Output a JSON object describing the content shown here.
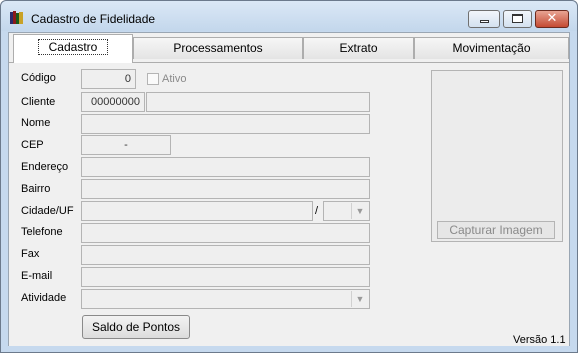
{
  "window": {
    "title": "Cadastro de Fidelidade",
    "minimize_icon": "minimize-icon",
    "maximize_icon": "maximize-icon",
    "close_icon": "close-icon",
    "close_glyph": "✕",
    "app_icon": "books-app-icon"
  },
  "tabs": [
    {
      "label": "Cadastro"
    },
    {
      "label": "Processamentos"
    },
    {
      "label": "Extrato"
    },
    {
      "label": "Movimentação"
    }
  ],
  "form": {
    "codigo": {
      "label": "Código",
      "value": "0"
    },
    "ativo": {
      "label": "Ativo",
      "checked": false
    },
    "cliente": {
      "label": "Cliente",
      "code": "00000000",
      "name": ""
    },
    "nome": {
      "label": "Nome",
      "value": ""
    },
    "cep": {
      "label": "CEP",
      "value": "-"
    },
    "endereco": {
      "label": "Endereço",
      "value": ""
    },
    "bairro": {
      "label": "Bairro",
      "value": ""
    },
    "cidade_uf": {
      "label": "Cidade/UF",
      "cidade": "",
      "separator": "/",
      "uf": ""
    },
    "telefone": {
      "label": "Telefone",
      "value": ""
    },
    "fax": {
      "label": "Fax",
      "value": ""
    },
    "email": {
      "label": "E-mail",
      "value": ""
    },
    "atividade": {
      "label": "Atividade",
      "value": ""
    }
  },
  "photo": {
    "capture_label": "Capturar Imagem"
  },
  "saldo_button": "Saldo de Pontos",
  "version": "Versão 1.1",
  "dropdown_glyph": "▼",
  "colors": {
    "title_bar": "#c3d7ec",
    "panel": "#f0f0f0",
    "close_button": "#c44a32"
  }
}
